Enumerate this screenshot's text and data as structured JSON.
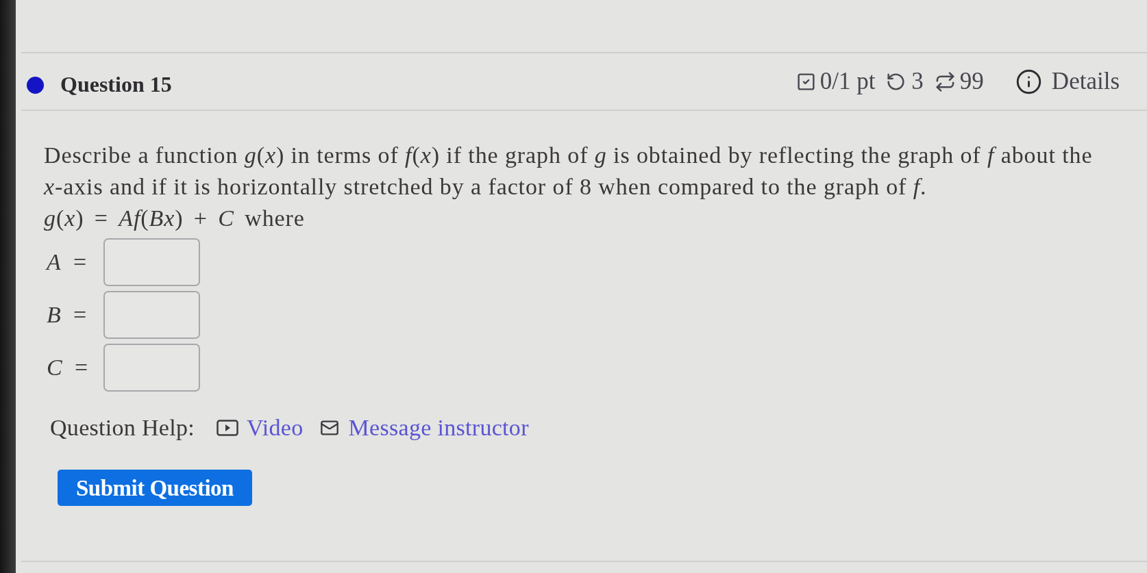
{
  "question": {
    "title": "Question 15",
    "score": "0/1 pt",
    "tries": "3",
    "regens": "99",
    "details_button": "Details"
  },
  "prompt": "Describe a function *g*(*x*) in terms of *f*(*x*) if the graph of *g* is obtained by reflecting the graph of *f* about the *x*-axis and if it is horizontally stretched by a factor of 8 when compared to the graph of *f*.",
  "formula": "*g*(*x*) = *Af*(*Bx*) + *C* where",
  "answers": [
    {
      "label": "*A* ="
    },
    {
      "label": "*B* ="
    },
    {
      "label": "*C* ="
    }
  ],
  "help": {
    "label": "Question Help:",
    "links": [
      {
        "kind": "video",
        "text": "Video"
      },
      {
        "kind": "message",
        "text": "Message instructor"
      }
    ]
  },
  "submit_button": "Submit Question"
}
